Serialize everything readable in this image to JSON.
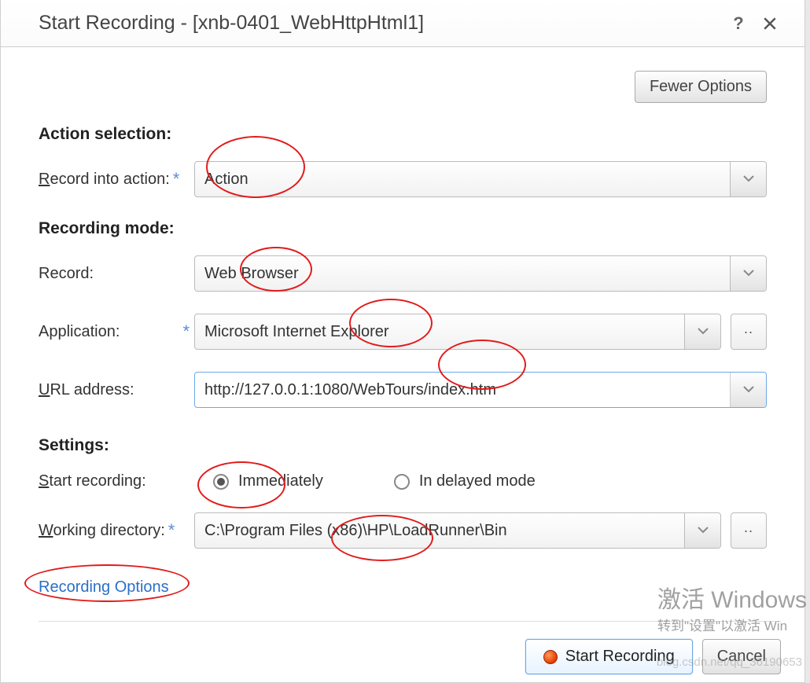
{
  "title": "Start Recording - [xnb-0401_WebHttpHtml1]",
  "fewer_options": "Fewer Options",
  "sections": {
    "action_selection": {
      "heading": "Action selection:",
      "record_into_label": "Record into action:",
      "record_into_value": "Action"
    },
    "recording_mode": {
      "heading": "Recording mode:",
      "record_label": "Record:",
      "record_value": "Web Browser",
      "application_label": "Application:",
      "application_value": "Microsoft Internet Explorer",
      "url_label": "URL address:",
      "url_value": "http://127.0.0.1:1080/WebTours/index.htm"
    },
    "settings": {
      "heading": "Settings:",
      "start_recording_label": "Start recording:",
      "radio_immediately": "Immediately",
      "radio_delayed": "In delayed mode",
      "workdir_label": "Working directory:",
      "workdir_value": "C:\\Program Files (x86)\\HP\\LoadRunner\\Bin"
    }
  },
  "link_recording_options": "Recording Options",
  "buttons": {
    "start_recording": "Start Recording",
    "cancel": "Cancel"
  },
  "watermark": {
    "big": "激活 Windows",
    "small": "转到\"设置\"以激活 Win"
  },
  "blog_watermark": "blog.csdn.net/qq_36190653"
}
